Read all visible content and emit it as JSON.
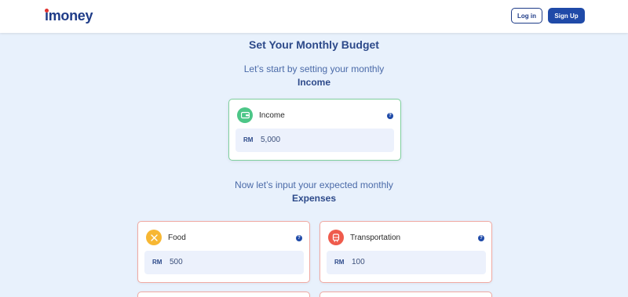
{
  "header": {
    "logo_text": "money",
    "logo_i": "i",
    "login_label": "Log in",
    "signup_label": "Sign Up"
  },
  "main": {
    "title": "Set Your Monthly Budget",
    "income_intro": "Let’s start by setting your monthly",
    "income_heading": "Income",
    "expenses_intro": "Now let’s input your expected monthly",
    "expenses_heading": "Expenses"
  },
  "income_card": {
    "label": "Income",
    "currency": "RM",
    "value": "5,000",
    "icon": "wallet-icon",
    "color": "#4cc687"
  },
  "expense_cards": [
    {
      "label": "Food",
      "currency": "RM",
      "value": "500",
      "icon": "utensils-icon",
      "color": "#f7b733"
    },
    {
      "label": "Transportation",
      "currency": "RM",
      "value": "100",
      "icon": "bus-icon",
      "color": "#ef5b4c"
    }
  ],
  "help_glyph": "?"
}
